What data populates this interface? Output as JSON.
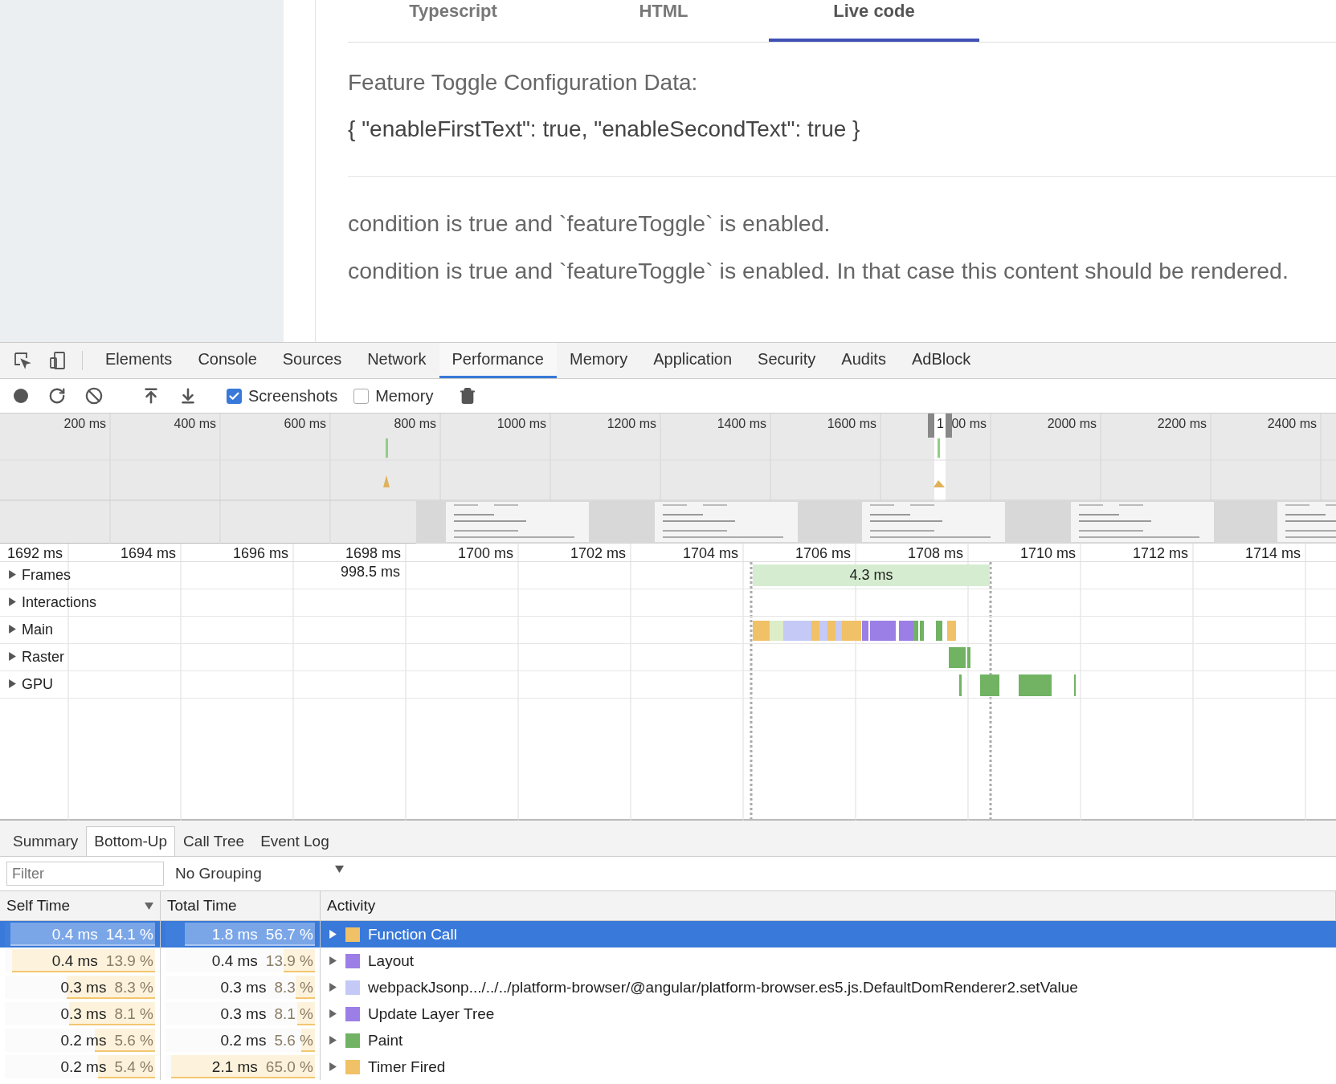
{
  "page": {
    "tabs": [
      {
        "label": "Typescript",
        "selected": false
      },
      {
        "label": "HTML",
        "selected": false
      },
      {
        "label": "Live code",
        "selected": true
      }
    ],
    "heading": "Feature Toggle Configuration Data:",
    "config": "{ \"enableFirstText\": true, \"enableSecondText\": true }",
    "lines": [
      "condition is true and `featureToggle` is enabled.",
      "condition is true and `featureToggle` is enabled. In that case this content should be rendered."
    ]
  },
  "devtools": {
    "tabs": [
      {
        "label": "Elements",
        "selected": false
      },
      {
        "label": "Console",
        "selected": false
      },
      {
        "label": "Sources",
        "selected": false
      },
      {
        "label": "Network",
        "selected": false
      },
      {
        "label": "Performance",
        "selected": true
      },
      {
        "label": "Memory",
        "selected": false
      },
      {
        "label": "Application",
        "selected": false
      },
      {
        "label": "Security",
        "selected": false
      },
      {
        "label": "Audits",
        "selected": false
      },
      {
        "label": "AdBlock",
        "selected": false
      }
    ],
    "toolbar": {
      "checkboxes": [
        {
          "label": "Screenshots",
          "checked": true
        },
        {
          "label": "Memory",
          "checked": false
        }
      ]
    },
    "overview": {
      "ticks": [
        "200 ms",
        "400 ms",
        "600 ms",
        "800 ms",
        "1000 ms",
        "1200 ms",
        "1400 ms",
        "1600 ms",
        "00 ms",
        "2000 ms",
        "2200 ms",
        "2400 ms"
      ],
      "handle_label": "1"
    },
    "ruler": [
      "1692 ms",
      "1694 ms",
      "1696 ms",
      "1698 ms",
      "1700 ms",
      "1702 ms",
      "1704 ms",
      "1706 ms",
      "1708 ms",
      "1710 ms",
      "1712 ms",
      "1714 ms"
    ],
    "tracks": [
      {
        "label": "Frames",
        "expanded": false
      },
      {
        "label": "Interactions",
        "expanded": false
      },
      {
        "label": "Main",
        "expanded": false
      },
      {
        "label": "Raster",
        "expanded": false
      },
      {
        "label": "GPU",
        "expanded": false
      }
    ],
    "frames": {
      "gap": "998.5 ms",
      "frame": "4.3 ms"
    },
    "details": {
      "tabs": [
        {
          "label": "Summary",
          "selected": false
        },
        {
          "label": "Bottom-Up",
          "selected": true
        },
        {
          "label": "Call Tree",
          "selected": false
        },
        {
          "label": "Event Log",
          "selected": false
        }
      ],
      "filter": {
        "placeholder": "Filter"
      },
      "grouping": "No Grouping",
      "columns": [
        {
          "label": "Self Time",
          "sorted": true
        },
        {
          "label": "Total Time",
          "sorted": false
        },
        {
          "label": "Activity",
          "sorted": false
        }
      ],
      "rows": [
        {
          "self": {
            "time": "0.4 ms",
            "percent": "14.1 %",
            "level": 0.96
          },
          "total": {
            "time": "1.8 ms",
            "percent": "56.7 %",
            "level": 0.87
          },
          "activity": "Function Call",
          "color": "#f0c166",
          "selected": true
        },
        {
          "self": {
            "time": "0.4 ms",
            "percent": "13.9 %",
            "level": 0.95
          },
          "total": {
            "time": "0.4 ms",
            "percent": "13.9 %",
            "level": 0.21
          },
          "activity": "Layout",
          "color": "#9b7fe6",
          "selected": false
        },
        {
          "self": {
            "time": "0.3 ms",
            "percent": "8.3 %",
            "level": 0.59
          },
          "total": {
            "time": "0.3 ms",
            "percent": "8.3 %",
            "level": 0.13
          },
          "activity": "webpackJsonp.../../../platform-browser/@angular/platform-browser.es5.js.DefaultDomRenderer2.setValue",
          "color": "#c4caf5",
          "selected": false
        },
        {
          "self": {
            "time": "0.3 ms",
            "percent": "8.1 %",
            "level": 0.57
          },
          "total": {
            "time": "0.3 ms",
            "percent": "8.1 %",
            "level": 0.12
          },
          "activity": "Update Layer Tree",
          "color": "#9b7fe6",
          "selected": false
        },
        {
          "self": {
            "time": "0.2 ms",
            "percent": "5.6 %",
            "level": 0.4
          },
          "total": {
            "time": "0.2 ms",
            "percent": "5.6 %",
            "level": 0.09
          },
          "activity": "Paint",
          "color": "#71b363",
          "selected": false
        },
        {
          "self": {
            "time": "0.2 ms",
            "percent": "5.4 %",
            "level": 0.38
          },
          "total": {
            "time": "2.1 ms",
            "percent": "65.0 %",
            "level": 0.96
          },
          "activity": "Timer Fired",
          "color": "#f0c166",
          "selected": false
        }
      ]
    }
  }
}
